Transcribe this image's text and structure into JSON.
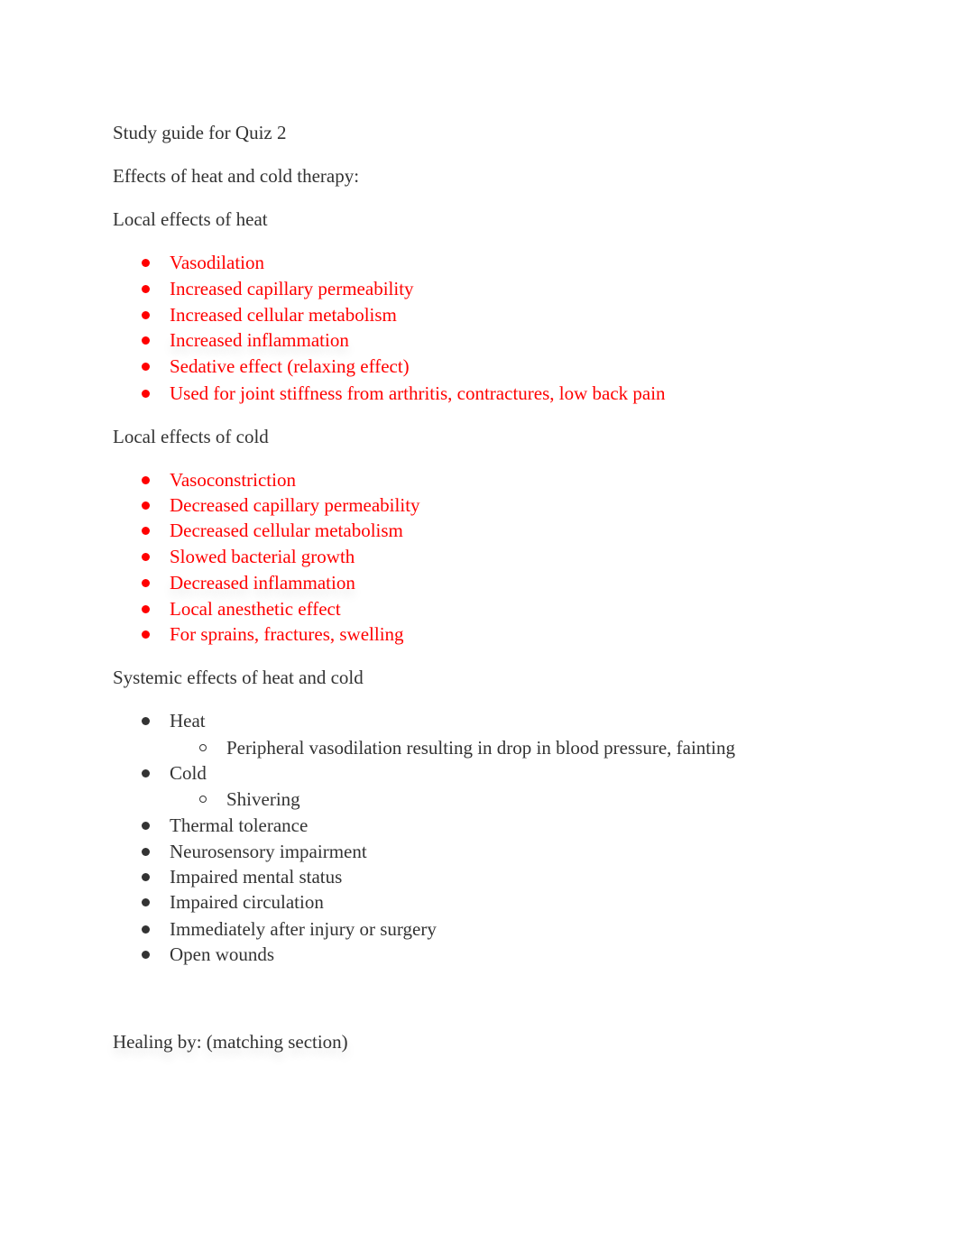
{
  "document": {
    "title": " Study guide for Quiz 2",
    "section_heading": "Effects of heat and cold therapy:",
    "heat": {
      "heading": "Local effects of heat",
      "items": [
        "Vasodilation",
        "Increased capillary permeability",
        "Increased cellular metabolism",
        "Increased inflammation",
        "Sedative effect (relaxing effect)",
        "Used for joint stiffness from arthritis, contractures, low back pain"
      ]
    },
    "cold": {
      "heading": "Local effects of cold",
      "items": [
        "Vasoconstriction",
        "Decreased capillary permeability",
        "Decreased cellular metabolism",
        "Slowed bacterial growth",
        "Decreased inflammation",
        "Local anesthetic effect",
        "For sprains, fractures, swelling"
      ]
    },
    "systemic": {
      "heading": "Systemic effects of heat and cold",
      "heat_label": "Heat",
      "heat_sub": "Peripheral vasodilation resulting in drop in blood pressure, fainting",
      "cold_label": "Cold",
      "cold_sub": "Shivering",
      "items": [
        "Thermal tolerance",
        "Neurosensory impairment",
        "Impaired mental status",
        "Impaired circulation",
        "Immediately after injury or surgery",
        "Open wounds"
      ]
    },
    "healing_heading": "Healing by: (matching section)",
    "colors": {
      "highlight": "#ff0000",
      "text": "#333333"
    }
  }
}
